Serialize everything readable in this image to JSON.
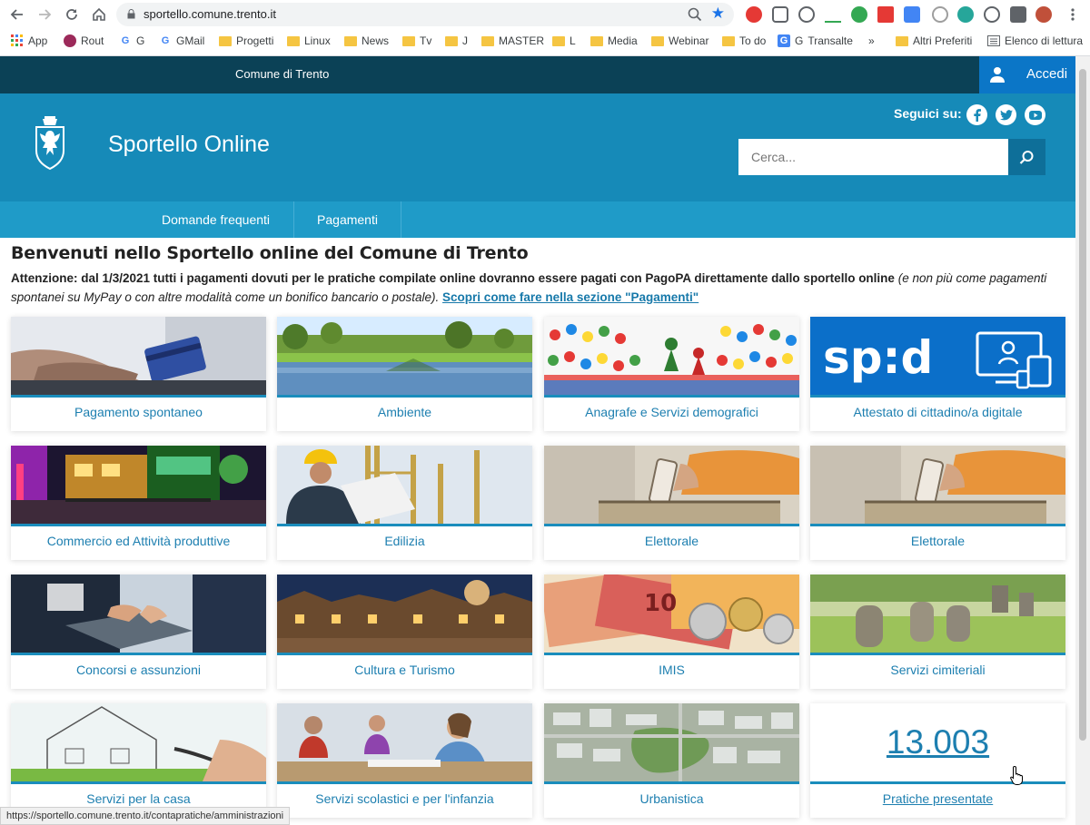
{
  "browser": {
    "url": "sportello.comune.trento.it",
    "bookmarks": [
      "App",
      "Rout",
      "G",
      "GMail",
      "Progetti",
      "Linux",
      "News",
      "Tv",
      "J",
      "MASTER",
      "L",
      "Media",
      "Webinar",
      "To do",
      "G",
      "Transalte",
      "Altri Preferiti",
      "Elenco di lettura"
    ],
    "more": "»",
    "status_url": "https://sportello.comune.trento.it/contapratiche/amministrazioni"
  },
  "topbar": {
    "municipality": "Comune di Trento",
    "login_label": "Accedi"
  },
  "header": {
    "title": "Sportello Online",
    "follow_label": "Seguici su:",
    "search_placeholder": "Cerca..."
  },
  "nav": [
    "Domande frequenti",
    "Pagamenti"
  ],
  "content": {
    "welcome": "Benvenuti nello Sportello online del Comune di Trento",
    "notice_bold": "Attenzione: dal 1/3/2021 tutti i pagamenti dovuti per le pratiche compilate online dovranno essere pagati con PagoPA direttamente dallo sportello online",
    "notice_italic": "(e non più come pagamenti spontanei su MyPay o con altre modalità come un bonifico bancario o postale).",
    "notice_link": "Scopri come fare nella sezione \"Pagamenti\""
  },
  "tiles": [
    "Pagamento spontaneo",
    "Ambiente",
    "Anagrafe e Servizi demografici",
    "Attestato di cittadino/a digitale",
    "Commercio ed Attività produttive",
    "Edilizia",
    "Elettorale",
    "Elettorale",
    "Concorsi e assunzioni",
    "Cultura e Turismo",
    "IMIS",
    "Servizi cimiteriali",
    "Servizi per la casa",
    "Servizi scolastici e per l'infanzia",
    "Urbanistica"
  ],
  "counter": {
    "value": "13.003",
    "label": "Pratiche presentate"
  },
  "spid_text": "sp:d",
  "colors": {
    "topbar": "#0b4156",
    "header": "#168ab8",
    "navbar": "#1f9bc8",
    "login": "#0b76c7",
    "link": "#1d7fb0"
  }
}
